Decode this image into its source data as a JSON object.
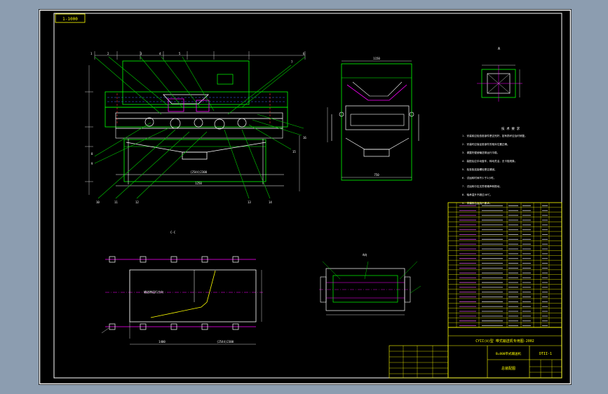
{
  "sheet_tag": "1-1000",
  "views": {
    "section_cc": "C-C",
    "detail_a": "A",
    "top_label": "A向",
    "plan_annotation": "输送带运行方向"
  },
  "dimensions": {
    "main_width": "(2544)2300",
    "main_total": "1250",
    "plan_left": "1400",
    "plan_right": "(2544)2300",
    "side_width": "1150",
    "side_bottom": "750"
  },
  "notes": {
    "title": "技 术 要 求",
    "lines": [
      "1. 安装前应检查各部件是否完好，如有损坏应及时修复。",
      "2. 安装时应保证各部件的相对位置正确。",
      "3. 调整托辊使输送带运行平稳。",
      "4. 装配后应手动盘车，转动灵活，无卡阻现象。",
      "5. 检查各连接螺栓是否紧固。",
      "6. 试运转时间不少于2小时。",
      "7. 试运转中应无异常噪声和振动。",
      "8. 轴承温升不超过40℃。",
      "9. 漆膜颜色按用户要求。"
    ]
  },
  "title_block": {
    "school": "CYII(Ⅱ)型  带式输送机专用图-2002",
    "drawing_name": "B=800带式输送机",
    "drawing_no": "DTII-1",
    "part": "总装配图"
  },
  "colors": {
    "background": "#000000",
    "frame": "#ffffff",
    "outline": "#00ff00",
    "leader": "#00cc00",
    "table": "#ffff00",
    "center": "#ff00ff",
    "dimension": "#ffffff",
    "hidden": "#ff3333",
    "blue": "#3a6cff"
  }
}
